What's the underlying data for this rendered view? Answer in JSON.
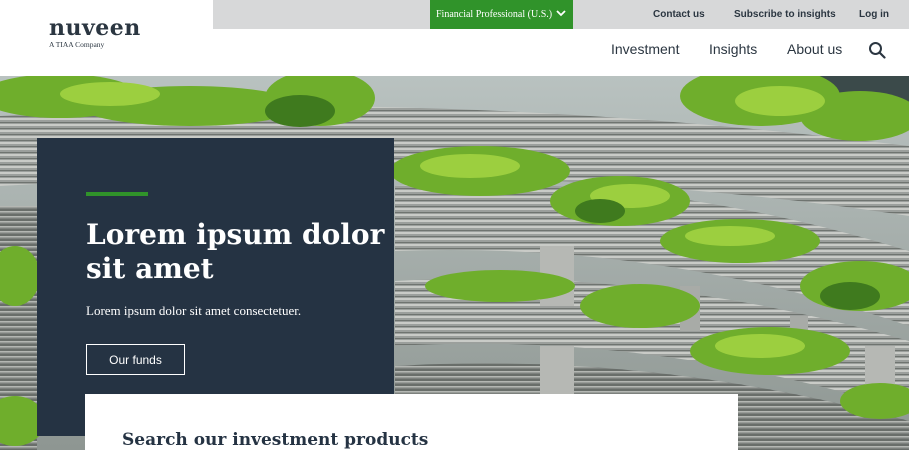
{
  "header": {
    "logo_text": "nuveen",
    "logo_sub": "A TIAA Company",
    "role_selector": "Financial Professional (U.S.)",
    "utility_links": {
      "contact": "Contact us",
      "subscribe": "Subscribe to insights",
      "login": "Log in"
    },
    "nav": {
      "investment": "Investment",
      "insights": "Insights",
      "about": "About us"
    },
    "icons": {
      "search": "search-icon",
      "chevron": "chevron-down-icon"
    }
  },
  "hero": {
    "title": "Lorem ipsum dolor sit amet",
    "subtitle": "Lorem ipsum dolor sit amet consectetuer.",
    "button_label": "Our funds",
    "image": "building-with-greenery"
  },
  "search_panel": {
    "heading": "Search our investment products"
  },
  "colors": {
    "brand_green": "#30932a",
    "navy": "#253343",
    "text_dark": "#2b3641",
    "util_bar": "#d7d8d9"
  }
}
